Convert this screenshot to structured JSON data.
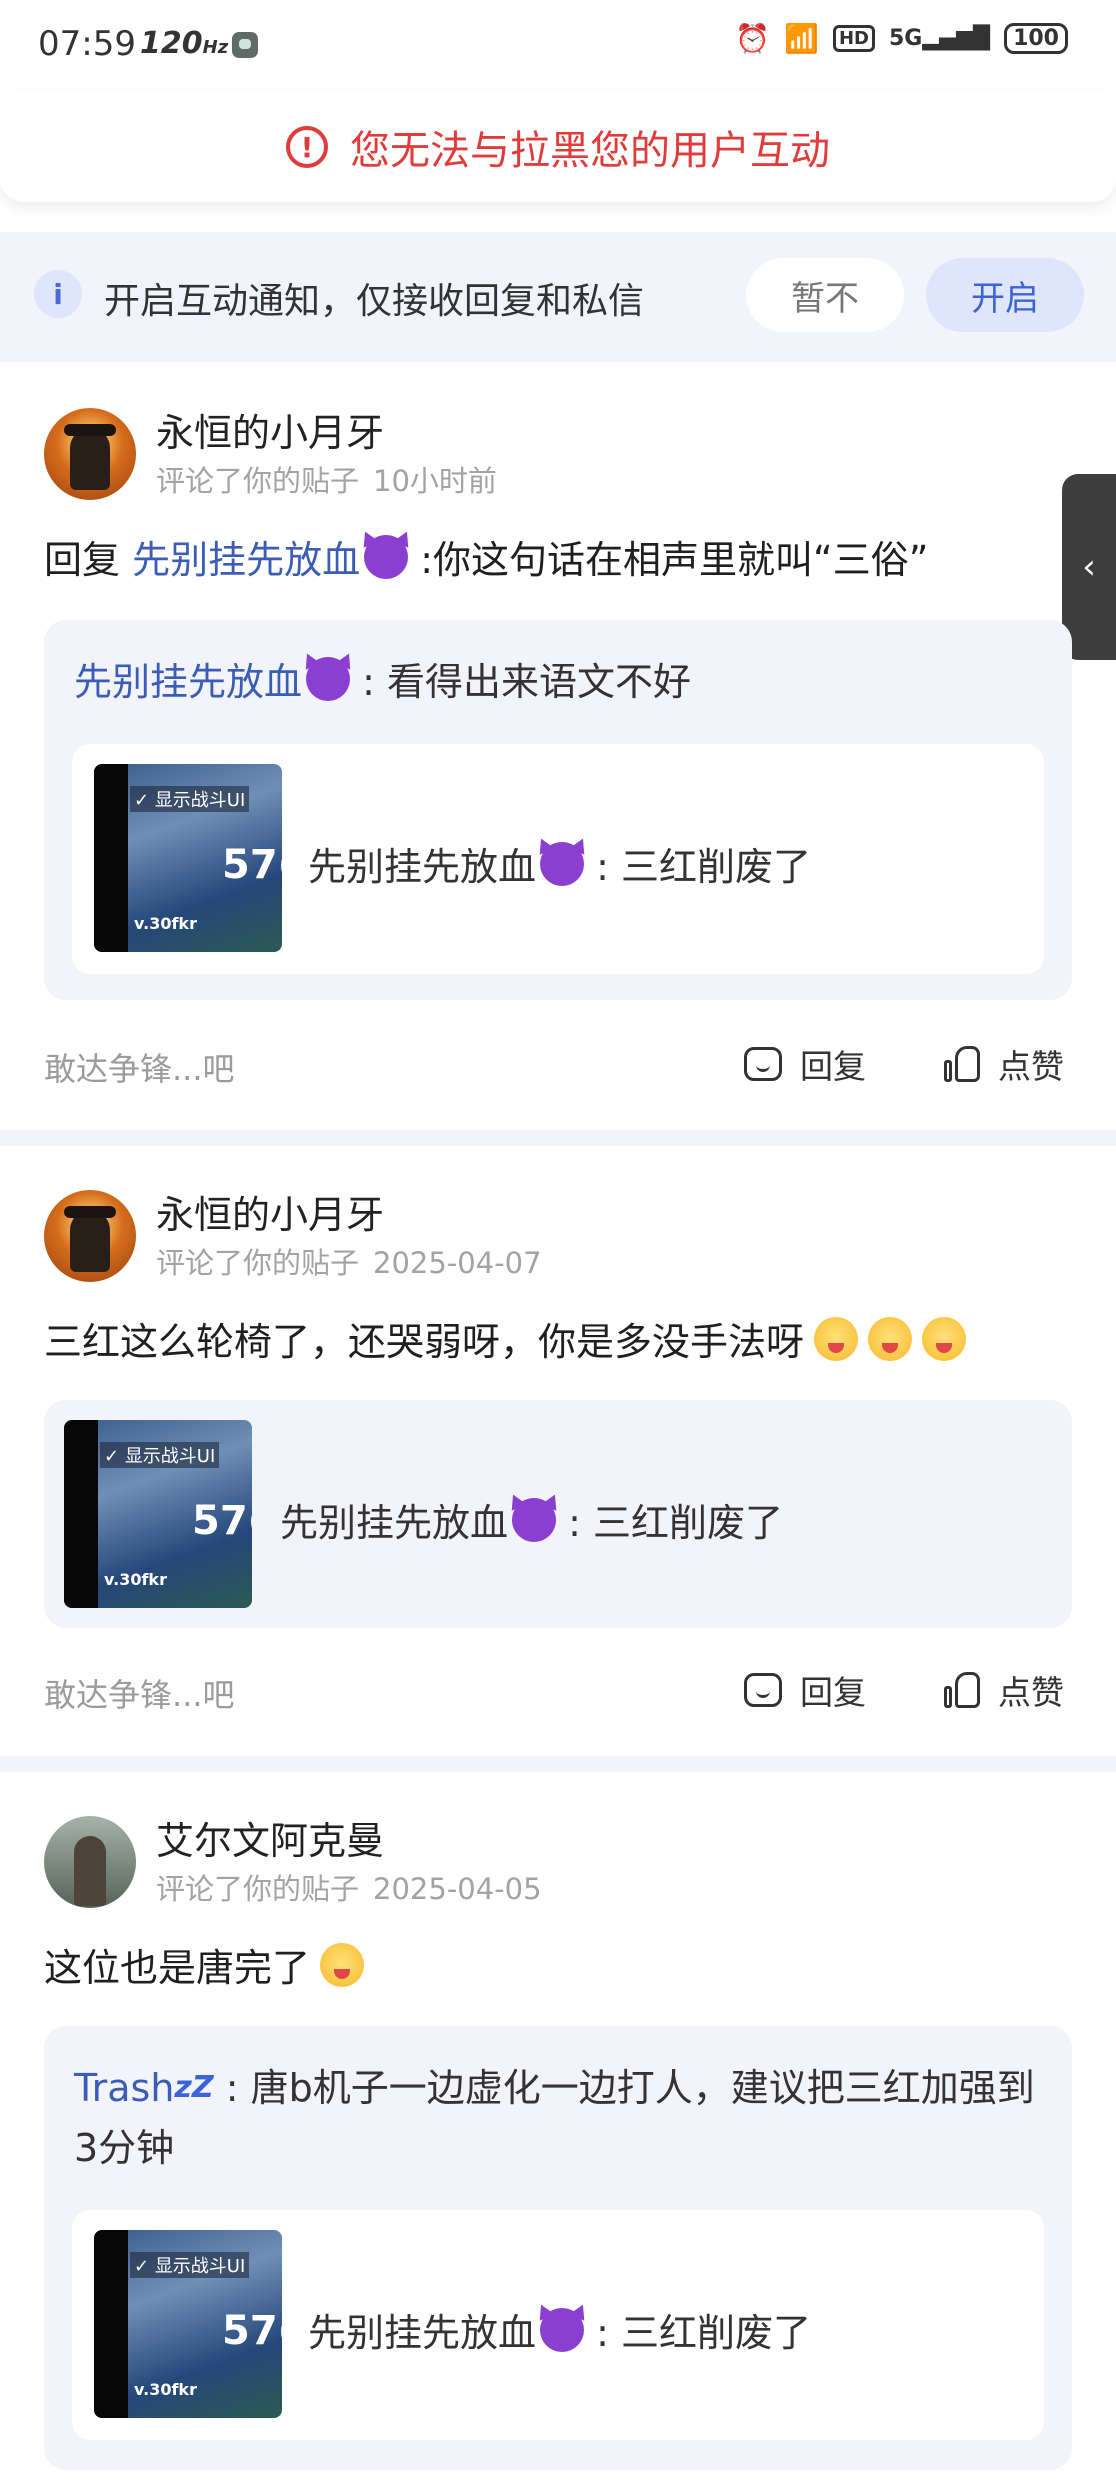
{
  "status_bar": {
    "time": "07:59",
    "refresh": "120",
    "refresh_unit": "Hz",
    "network": "5G",
    "hd": "HD",
    "battery": "100"
  },
  "block_banner": {
    "text": "您无法与拉黑您的用户互动"
  },
  "notify_bar": {
    "text": "开启互动通知，仅接收回复和私信",
    "later_label": "暂不",
    "enable_label": "开启"
  },
  "thumbnail": {
    "badge": "显示战斗UI",
    "number": "57(",
    "sub": "v.30fkr"
  },
  "actions": {
    "reply_label": "回复",
    "like_label": "点赞",
    "hint": "敢达争锋...吧"
  },
  "notifications": [
    {
      "username": "永恒的小月牙",
      "action": "评论了你的贴子",
      "time": "10小时前",
      "reply_prefix": "回复",
      "reply_to": "先别挂先放血",
      "comment": ":你这句话在相声里就叫“三俗”",
      "quote_user": "先别挂先放血",
      "quote_text": ": 看得出来语文不好",
      "card_user": "先别挂先放血",
      "card_text": ": 三红削废了"
    },
    {
      "username": "永恒的小月牙",
      "action": "评论了你的贴子",
      "time": "2025-04-07",
      "comment": "三红这么轮椅了，还哭弱呀，你是多没手法呀",
      "card_user": "先别挂先放血",
      "card_text": ": 三红削废了"
    },
    {
      "username": "艾尔文阿克曼",
      "action": "评论了你的贴子",
      "time": "2025-04-05",
      "comment": "这位也是唐完了",
      "quote_user": "Trash",
      "quote_text": ": 唐b机子一边虚化一边打人，建议把三红加强到3分钟",
      "card_user": "先别挂先放血",
      "card_text": ": 三红削废了"
    }
  ],
  "side_tab": {
    "icon": "chevron-left-icon"
  }
}
